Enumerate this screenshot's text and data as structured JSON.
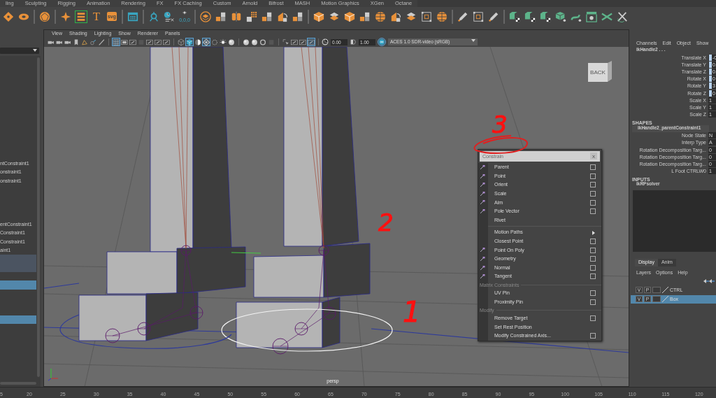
{
  "shelf": {
    "tabs": [
      "ling",
      "Sculpting",
      "Rigging",
      "Animation",
      "Rendering",
      "FX",
      "FX Caching",
      "Custom",
      "Arnold",
      "Bifrost",
      "MASH",
      "Motion Graphics",
      "XGen",
      "Octane"
    ],
    "groups": [
      [
        {
          "kind": "diamond",
          "selected": false
        },
        {
          "kind": "ring",
          "selected": false
        }
      ],
      [
        {
          "kind": "polyhedron",
          "selected": false
        }
      ],
      [
        {
          "kind": "star",
          "selected": false
        },
        {
          "kind": "lattice",
          "selected": true
        },
        {
          "kind": "letter",
          "label": "T",
          "selected": false
        },
        {
          "kind": "badge",
          "label": "svg",
          "selected": false
        }
      ],
      [
        {
          "kind": "window",
          "selected": false
        }
      ],
      [
        {
          "kind": "joint",
          "selected": false
        },
        {
          "kind": "clock",
          "selected": false
        },
        {
          "kind": "locator",
          "label": "0,0,0",
          "selected": false
        }
      ],
      [
        {
          "kind": "layers",
          "selected": false
        },
        {
          "kind": "tiles",
          "selected": false
        },
        {
          "kind": "split",
          "selected": false
        },
        {
          "kind": "grid",
          "selected": false
        },
        {
          "kind": "tiles",
          "selected": false
        },
        {
          "kind": "wedge",
          "selected": false
        },
        {
          "kind": "tiles",
          "selected": false
        }
      ],
      [
        {
          "kind": "cube",
          "selected": false
        },
        {
          "kind": "stack",
          "selected": false
        },
        {
          "kind": "cube",
          "selected": false
        },
        {
          "kind": "tiles",
          "selected": false
        },
        {
          "kind": "sphere",
          "selected": false
        },
        {
          "kind": "wedge",
          "selected": false
        },
        {
          "kind": "stack",
          "selected": false
        },
        {
          "kind": "bounds",
          "selected": false
        },
        {
          "kind": "sphere",
          "selected": false
        }
      ],
      [
        {
          "kind": "pencil",
          "selected": false
        },
        {
          "kind": "bounds",
          "selected": false
        },
        {
          "kind": "pencil",
          "selected": false
        }
      ],
      [
        {
          "kind": "uv",
          "selected": false
        },
        {
          "kind": "uv",
          "selected": false
        },
        {
          "kind": "uv",
          "selected": false
        },
        {
          "kind": "uvcube",
          "selected": false
        },
        {
          "kind": "uvwave",
          "selected": false
        },
        {
          "kind": "uvwindow",
          "selected": false
        },
        {
          "kind": "cross",
          "selected": false
        },
        {
          "kind": "knife",
          "selected": false
        }
      ]
    ]
  },
  "outliner": {
    "rows": [
      {
        "label": "ntConstraint1",
        "selected": false,
        "highlighted": false
      },
      {
        "label": "onstraint1",
        "selected": false,
        "highlighted": false
      },
      {
        "label": "onstraint1",
        "selected": false,
        "highlighted": false
      },
      {
        "selected": false,
        "highlighted": false
      },
      {
        "selected": false,
        "highlighted": false
      },
      {
        "selected": false,
        "highlighted": false
      },
      {
        "selected": false,
        "highlighted": false
      },
      {
        "label": "entConstraint1",
        "selected": false,
        "highlighted": false
      },
      {
        "label": "Constraint1",
        "selected": false,
        "highlighted": false
      },
      {
        "label": "Constraint1",
        "selected": false,
        "highlighted": false
      },
      {
        "label": "aint1",
        "selected": false,
        "highlighted": false
      },
      {
        "selected": false,
        "highlighted": true
      },
      {
        "selected": false,
        "highlighted": true
      },
      {
        "selected": false,
        "highlighted": false
      },
      {
        "selected": true,
        "highlighted": false
      },
      {
        "selected": false,
        "highlighted": false
      },
      {
        "selected": false,
        "highlighted": false
      },
      {
        "selected": false,
        "highlighted": false
      },
      {
        "selected": true,
        "highlighted": false
      }
    ]
  },
  "viewport": {
    "menu": [
      "View",
      "Shading",
      "Lighting",
      "Show",
      "Renderer",
      "Panels"
    ],
    "toolbar": [
      [
        {
          "kind": "camera",
          "on": false
        },
        {
          "kind": "camera",
          "on": false
        },
        {
          "kind": "camera",
          "on": false
        },
        {
          "kind": "bookmark",
          "on": false
        },
        {
          "kind": "plane",
          "on": false
        },
        {
          "kind": "sequence",
          "on": false
        },
        {
          "kind": "brush",
          "on": false
        }
      ],
      [
        {
          "kind": "grid",
          "on": true
        },
        {
          "kind": "film",
          "on": false
        },
        {
          "kind": "frame",
          "on": false
        },
        {
          "kind": "dark",
          "on": false
        },
        {
          "kind": "frame",
          "on": false
        },
        {
          "kind": "frame",
          "on": false
        },
        {
          "kind": "frame",
          "on": false
        }
      ],
      [
        {
          "kind": "wirecube",
          "on": false
        },
        {
          "kind": "shadedcube",
          "on": true
        },
        {
          "kind": "halfcircle",
          "on": false
        },
        {
          "kind": "texture",
          "on": true
        },
        {
          "kind": "checker",
          "on": false
        },
        {
          "kind": "light",
          "on": false
        },
        {
          "kind": "sphere",
          "on": false
        }
      ],
      [
        {
          "kind": "sphere",
          "on": false
        },
        {
          "kind": "sphere",
          "on": false
        },
        {
          "kind": "ring",
          "on": false
        },
        {
          "kind": "dark",
          "on": false
        }
      ],
      [
        {
          "kind": "cursor",
          "on": false
        },
        {
          "kind": "frame",
          "on": false
        },
        {
          "kind": "frame",
          "on": false
        },
        {
          "kind": "frame",
          "on": true
        }
      ]
    ],
    "exposure": "0.00",
    "gamma": "1.00",
    "view_transform_on": true,
    "color_space": "ACES 1.0 SDR-video (sRGB)",
    "view_cube": "BACK",
    "camera": "persp",
    "annotations": [
      "3",
      "2",
      "1"
    ]
  },
  "constrain_menu": {
    "title": "Constrain",
    "close": "x",
    "items": [
      {
        "kind": "item",
        "label": "Parent",
        "icon": true,
        "option_box": true
      },
      {
        "kind": "item",
        "label": "Point",
        "icon": true,
        "option_box": true
      },
      {
        "kind": "item",
        "label": "Orient",
        "icon": true,
        "option_box": true
      },
      {
        "kind": "item",
        "label": "Scale",
        "icon": true,
        "option_box": true
      },
      {
        "kind": "item",
        "label": "Aim",
        "icon": true,
        "option_box": true
      },
      {
        "kind": "item",
        "label": "Pole Vector",
        "icon": true,
        "option_box": true
      },
      {
        "kind": "item",
        "label": "Rivet",
        "icon": false,
        "option_box": false
      },
      {
        "kind": "divider"
      },
      {
        "kind": "submenu",
        "label": "Motion Paths"
      },
      {
        "kind": "item",
        "label": "Closest Point",
        "icon": false,
        "option_box": true
      },
      {
        "kind": "item",
        "label": "Point On Poly",
        "icon": true,
        "option_box": true
      },
      {
        "kind": "item",
        "label": "Geometry",
        "icon": true,
        "option_box": true
      },
      {
        "kind": "item",
        "label": "Normal",
        "icon": true,
        "option_box": true
      },
      {
        "kind": "item",
        "label": "Tangent",
        "icon": true,
        "option_box": true
      },
      {
        "kind": "header",
        "label": "Matrix Constraints"
      },
      {
        "kind": "item",
        "label": "UV Pin",
        "icon": false,
        "option_box": true
      },
      {
        "kind": "item",
        "label": "Proximity Pin",
        "icon": false,
        "option_box": true
      },
      {
        "kind": "header",
        "label": "Modify"
      },
      {
        "kind": "item",
        "label": "Remove Target",
        "icon": false,
        "option_box": true
      },
      {
        "kind": "item",
        "label": "Set Rest Position",
        "icon": false,
        "option_box": false
      },
      {
        "kind": "item",
        "label": "Modify Constrained Axis...",
        "icon": false,
        "option_box": true
      }
    ]
  },
  "channel_box": {
    "menu": [
      "Channels",
      "Edit",
      "Object",
      "Show"
    ],
    "node": "ikHandle2 . . .",
    "attributes": [
      {
        "name": "Translate X",
        "value": "-0",
        "keyed": true
      },
      {
        "name": "Translate Y",
        "value": "0.",
        "keyed": true
      },
      {
        "name": "Translate Z",
        "value": "0.",
        "keyed": true
      },
      {
        "name": "Rotate X",
        "value": "0",
        "keyed": true
      },
      {
        "name": "Rotate Y",
        "value": "3",
        "keyed": true
      },
      {
        "name": "Rotate Z",
        "value": "0",
        "keyed": true
      },
      {
        "name": "Scale X",
        "value": "1",
        "keyed": false
      },
      {
        "name": "Scale Y",
        "value": "1",
        "keyed": false
      },
      {
        "name": "Scale Z",
        "value": "1",
        "keyed": false
      }
    ],
    "shapes_heading": "SHAPES",
    "shape_node": "ikHandle2_parentConstraint1",
    "shape_attributes": [
      {
        "name": "Node State",
        "value": "N"
      },
      {
        "name": "Interp Type",
        "value": "A"
      },
      {
        "name": "Rotation Decomposition Targ...",
        "value": "0"
      },
      {
        "name": "Rotation Decomposition Targ...",
        "value": "0"
      },
      {
        "name": "Rotation Decomposition Targ...",
        "value": "0"
      },
      {
        "name": "L Foot CTRLW0",
        "value": "1"
      }
    ],
    "inputs_heading": "INPUTS",
    "input_node": "ikRPsolver"
  },
  "layer_editor": {
    "tabs": [
      {
        "label": "Display",
        "selected": true
      },
      {
        "label": "Anim",
        "selected": false
      }
    ],
    "menu": [
      "Layers",
      "Options",
      "Help"
    ],
    "layers": [
      {
        "visible": "V",
        "playback": "P",
        "name": "CTRL",
        "selected": false
      },
      {
        "visible": "V",
        "playback": "P",
        "name": "Box",
        "selected": true
      }
    ]
  },
  "timeline": {
    "ticks": [
      "5",
      "20",
      "25",
      "30",
      "35",
      "40",
      "45",
      "50",
      "55",
      "60",
      "65",
      "70",
      "75",
      "80",
      "85",
      "90",
      "95",
      "100",
      "105",
      "110",
      "115",
      "120"
    ]
  }
}
